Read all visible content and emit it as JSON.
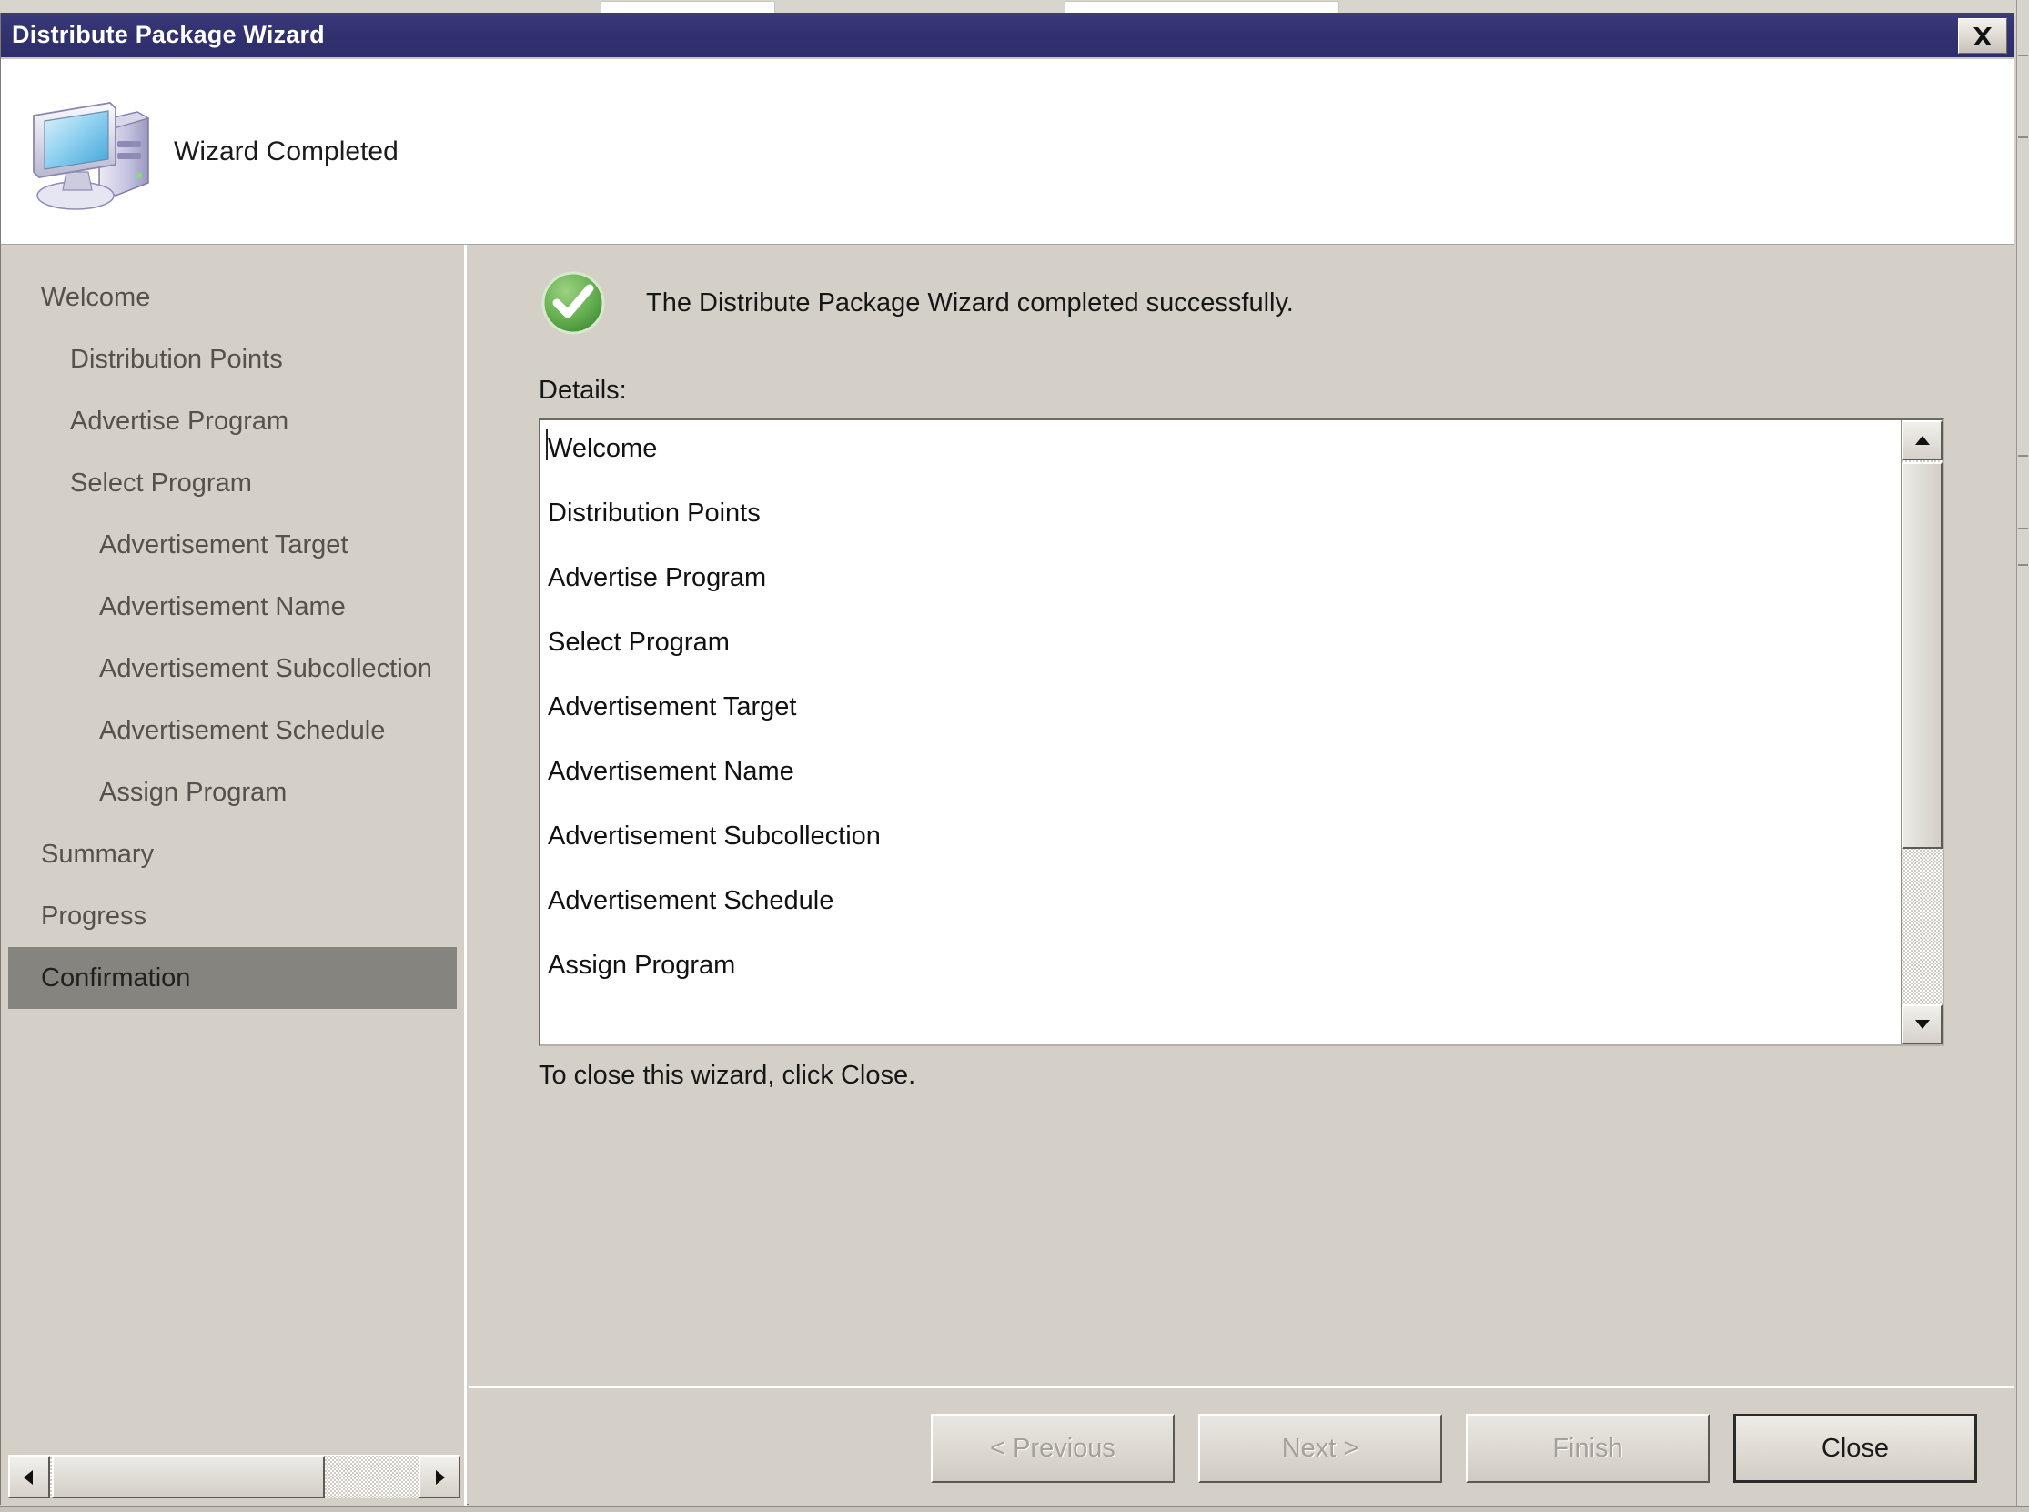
{
  "window": {
    "title": "Distribute Package Wizard",
    "close_button": "close-icon"
  },
  "banner": {
    "title": "Wizard Completed",
    "icon": "computer-icon"
  },
  "sidebar": {
    "items": [
      {
        "label": "Welcome",
        "level": 1,
        "selected": false
      },
      {
        "label": "Distribution Points",
        "level": 2,
        "selected": false
      },
      {
        "label": "Advertise Program",
        "level": 2,
        "selected": false
      },
      {
        "label": "Select Program",
        "level": 2,
        "selected": false
      },
      {
        "label": "Advertisement Target",
        "level": 3,
        "selected": false
      },
      {
        "label": "Advertisement Name",
        "level": 3,
        "selected": false
      },
      {
        "label": "Advertisement Subcollection",
        "level": 3,
        "selected": false
      },
      {
        "label": "Advertisement Schedule",
        "level": 3,
        "selected": false
      },
      {
        "label": "Assign Program",
        "level": 3,
        "selected": false
      },
      {
        "label": "Summary",
        "level": 1,
        "selected": false
      },
      {
        "label": "Progress",
        "level": 1,
        "selected": false
      },
      {
        "label": "Confirmation",
        "level": 1,
        "selected": true
      }
    ]
  },
  "content": {
    "status_message": "The Distribute Package Wizard completed successfully.",
    "status_icon": "success-check-icon",
    "details_label": "Details:",
    "details_items": [
      "Welcome",
      "Distribution Points",
      "Advertise Program",
      "Select Program",
      "Advertisement Target",
      "Advertisement Name",
      "Advertisement Subcollection",
      "Advertisement Schedule",
      "Assign Program"
    ],
    "close_hint": "To close this wizard, click Close."
  },
  "footer": {
    "buttons": [
      {
        "label": "< Previous",
        "enabled": false,
        "default": false
      },
      {
        "label": "Next >",
        "enabled": false,
        "default": false
      },
      {
        "label": "Finish",
        "enabled": false,
        "default": false
      },
      {
        "label": "Close",
        "enabled": true,
        "default": true
      }
    ]
  },
  "colors": {
    "titlebar": "#31316f",
    "dialog_face": "#d4d0c8",
    "selection": "#85847e",
    "success_green": "#4d9b3f"
  }
}
